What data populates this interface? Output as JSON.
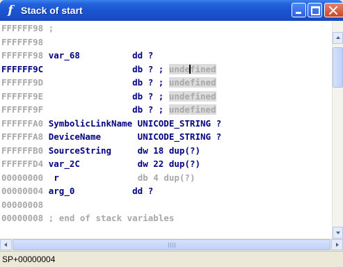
{
  "window": {
    "title": "Stack of start",
    "icon": "f-function-icon"
  },
  "lines": [
    {
      "addr": "FFFFFF98",
      "style": "dim",
      "text": " ;"
    },
    {
      "addr": "FFFFFF98",
      "style": "dim",
      "text": ""
    },
    {
      "addr": "FFFFFF98",
      "style": "dim",
      "text": " var_68          dd ?"
    },
    {
      "addr": "FFFFFF9C",
      "style": "bold",
      "text": "                 db ? ; ",
      "comment": "undefined",
      "caret_after": "unde"
    },
    {
      "addr": "FFFFFF9D",
      "style": "dim",
      "text": "                 db ? ; ",
      "comment": "undefined"
    },
    {
      "addr": "FFFFFF9E",
      "style": "dim",
      "text": "                 db ? ; ",
      "comment": "undefined"
    },
    {
      "addr": "FFFFFF9F",
      "style": "dim",
      "text": "                 db ? ; ",
      "comment": "undefined"
    },
    {
      "addr": "FFFFFFA0",
      "style": "dim",
      "text": " SymbolicLinkName UNICODE_STRING ?"
    },
    {
      "addr": "FFFFFFA8",
      "style": "dim",
      "text": " DeviceName       UNICODE_STRING ?"
    },
    {
      "addr": "FFFFFFB0",
      "style": "dim",
      "text": " SourceString     dw 18 dup(?)"
    },
    {
      "addr": "FFFFFFD4",
      "style": "dim",
      "text": " var_2C           dw 22 dup(?)"
    },
    {
      "addr": "00000000",
      "style": "zero",
      "text": "  r               ",
      "gray_tail": "db 4 dup(?)"
    },
    {
      "addr": "00000004",
      "style": "zero",
      "text": " arg_0           dd ?"
    },
    {
      "addr": "00000008",
      "style": "zero",
      "text": ""
    },
    {
      "addr": "00000008",
      "style": "zero",
      "text": " ; end of stack variables"
    }
  ],
  "status": {
    "position": "SP+00000004"
  },
  "colors": {
    "title_bar": "#1a55d0",
    "code_text": "#000080",
    "dim_text": "#a8a8a8",
    "highlight": "#dcdcdc"
  }
}
